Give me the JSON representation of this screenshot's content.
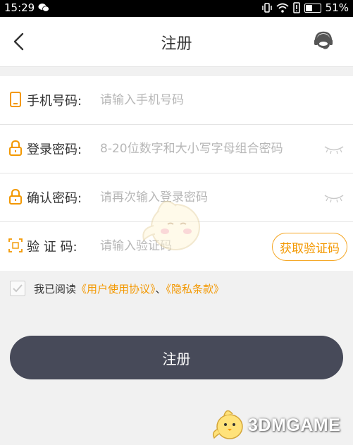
{
  "status_bar": {
    "time": "15:29",
    "battery_text": "51%",
    "battery_level": 0.51
  },
  "header": {
    "title": "注册",
    "back_icon": "chevron-left-icon",
    "service_icon": "customer-service-headset-icon"
  },
  "form": {
    "phone": {
      "label": "手机号码:",
      "placeholder": "请输入手机号码",
      "icon": "phone-icon"
    },
    "password": {
      "label": "登录密码:",
      "placeholder": "8-20位数字和大小写字母组合密码",
      "icon": "lock-icon"
    },
    "confirm": {
      "label": "确认密码:",
      "placeholder": "请再次输入登录密码",
      "icon": "lock-icon"
    },
    "code": {
      "label": "验 证 码:",
      "placeholder": "请输入验证码",
      "icon": "scan-icon",
      "button_label": "获取验证码"
    }
  },
  "agreement": {
    "prefix": "我已阅读",
    "user_agreement": "《用户使用协议》",
    "separator": "、",
    "privacy": "《隐私条款》"
  },
  "submit_label": "注册",
  "watermark": {
    "text": "3DMGAME"
  },
  "colors": {
    "accent": "#f39800",
    "button_bg": "#474a59",
    "page_bg": "#f1f1f1",
    "placeholder": "#b7b7b7"
  }
}
